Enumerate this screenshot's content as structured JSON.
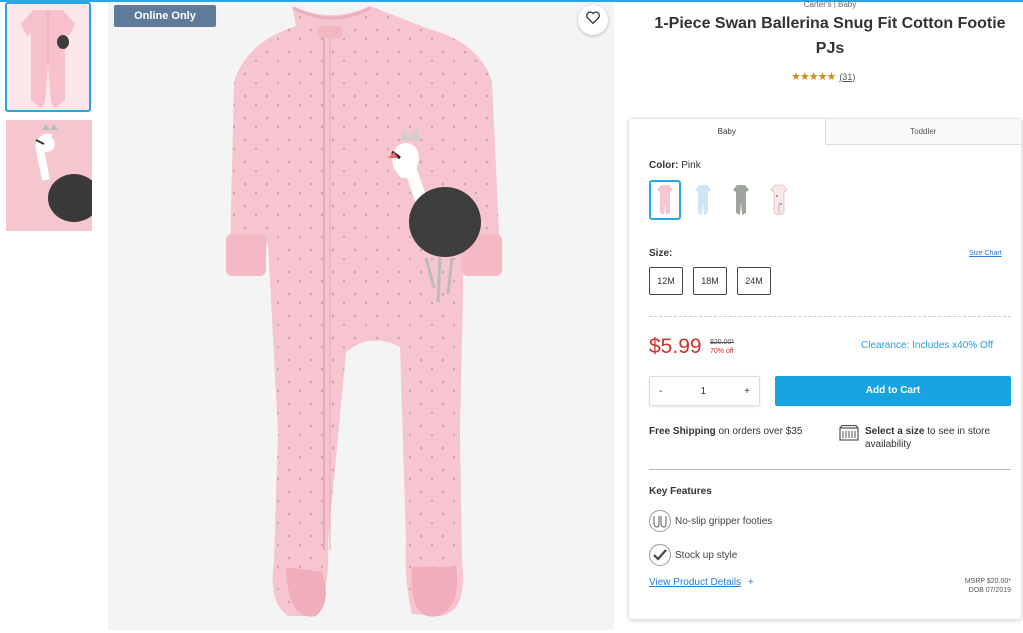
{
  "badge": "Online Only",
  "product": {
    "brand": "Carter's | Baby",
    "title": "1-Piece Swan Ballerina Snug Fit Cotton Footie PJs",
    "stars": "★★★★★",
    "rating_value": 5,
    "review_count": "(31)"
  },
  "tabs": [
    {
      "label": "Baby"
    },
    {
      "label": "Toddler"
    }
  ],
  "color": {
    "label": "Color:",
    "value": "Pink"
  },
  "swatches": [
    {
      "name": "Pink",
      "color": "#f7c7d0"
    },
    {
      "name": "Blue",
      "color": "#cfe4f4"
    },
    {
      "name": "Gray",
      "color": "#9ea59c"
    },
    {
      "name": "White Print",
      "color": "#f4eaea"
    }
  ],
  "size": {
    "label": "Size:",
    "chart_link": "Size Chart",
    "options": [
      "12M",
      "18M",
      "24M"
    ]
  },
  "price": {
    "current": "$5.99",
    "original": "$20.00*",
    "discount": "70% off",
    "clearance": "Clearance: Includes x40% Off"
  },
  "quantity": {
    "minus": "-",
    "value": "1",
    "plus": "+"
  },
  "cart_button": "Add to Cart",
  "shipping": {
    "bold": "Free Shipping",
    "text": " on orders over $35"
  },
  "store": {
    "bold": "Select a size",
    "text": " to see in store availability"
  },
  "key_features": {
    "title": "Key Features",
    "items": [
      {
        "label": "No-slip gripper footies",
        "icon": "footie-icon"
      },
      {
        "label": "Stock up style",
        "icon": "check-icon"
      }
    ]
  },
  "details_link": "View Product Details",
  "details_plus": "+",
  "msrp": {
    "line1": "MSRP $20.00*",
    "line2": "DOB 07/2019"
  },
  "colors": {
    "accent": "#18a4e0",
    "sale": "#d0312d",
    "badge": "#5f7b99",
    "stars": "#d38b1d"
  }
}
